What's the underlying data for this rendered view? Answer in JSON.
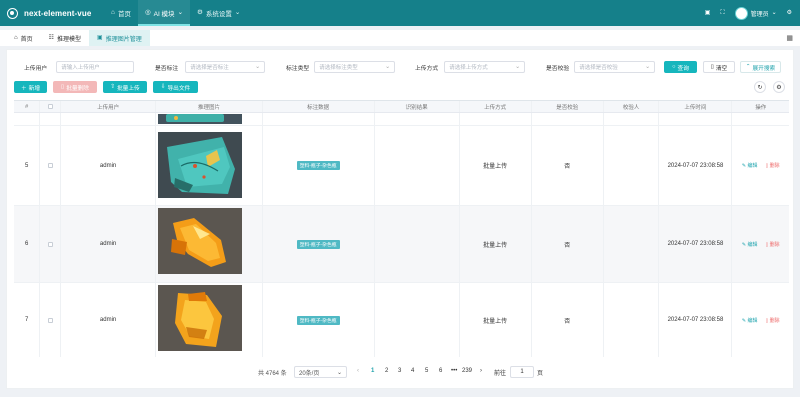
{
  "app": {
    "title": "next-element-vue"
  },
  "topnav": {
    "home": "首页",
    "ai": "AI 模块",
    "settings": "系统设置",
    "user": "管理员"
  },
  "tabs": [
    {
      "label": "首页"
    },
    {
      "label": "推理模型"
    },
    {
      "label": "推理图片管理"
    }
  ],
  "search": {
    "uploader_label": "上传用户",
    "uploader_placeholder": "请输入上传用户",
    "marked_label": "是否标注",
    "marked_placeholder": "请选择是否标注",
    "mark_type_label": "标注类型",
    "mark_type_placeholder": "请选择标注类型",
    "upload_method_label": "上传方式",
    "upload_method_placeholder": "请选择上传方式",
    "verified_label": "是否校验",
    "verified_placeholder": "请选择是否校验",
    "search_button": "查询",
    "clear_button": "清空",
    "expand_button": "展开搜索"
  },
  "actions": {
    "add": "新增",
    "batch_delete": "批量删除",
    "batch_upload": "批量上传",
    "export": "导出文件"
  },
  "columns": {
    "index": "#",
    "uploader": "上传用户",
    "image": "推理图片",
    "mark_data": "标注数据",
    "result": "识别结果",
    "upload_method": "上传方式",
    "verified": "是否校验",
    "verifier": "校验人",
    "upload_time": "上传时间",
    "operation": "操作"
  },
  "rows": [
    {
      "index": "5",
      "uploader": "admin",
      "tag": "塑料-瓶子-杂色瓶",
      "upload_method": "批量上传",
      "verified": "否",
      "time": "2024-07-07 23:08:58",
      "edit": "编辑",
      "delete": "删除",
      "image": "teal-crushed-bottle"
    },
    {
      "index": "6",
      "uploader": "admin",
      "tag": "塑料-瓶子-杂色瓶",
      "upload_method": "批量上传",
      "verified": "否",
      "time": "2024-07-07 23:08:58",
      "edit": "编辑",
      "delete": "删除",
      "image": "orange-crushed-bottle"
    },
    {
      "index": "7",
      "uploader": "admin",
      "tag": "塑料-瓶子-杂色瓶",
      "upload_method": "批量上传",
      "verified": "否",
      "time": "2024-07-07 23:08:58",
      "edit": "编辑",
      "delete": "删除",
      "image": "orange-crushed-bottle"
    }
  ],
  "pagination": {
    "total": "共 4764 条",
    "page_size": "20条/页",
    "pages": [
      "1",
      "2",
      "3",
      "4",
      "5",
      "6",
      "•••",
      "239"
    ],
    "goto_label": "前往",
    "goto_value": "1",
    "page_unit": "页"
  },
  "colors": {
    "brand": "#15808a",
    "accent": "#16b6bd",
    "danger": "#ee6c6c",
    "tag": "#4fb9c4"
  }
}
